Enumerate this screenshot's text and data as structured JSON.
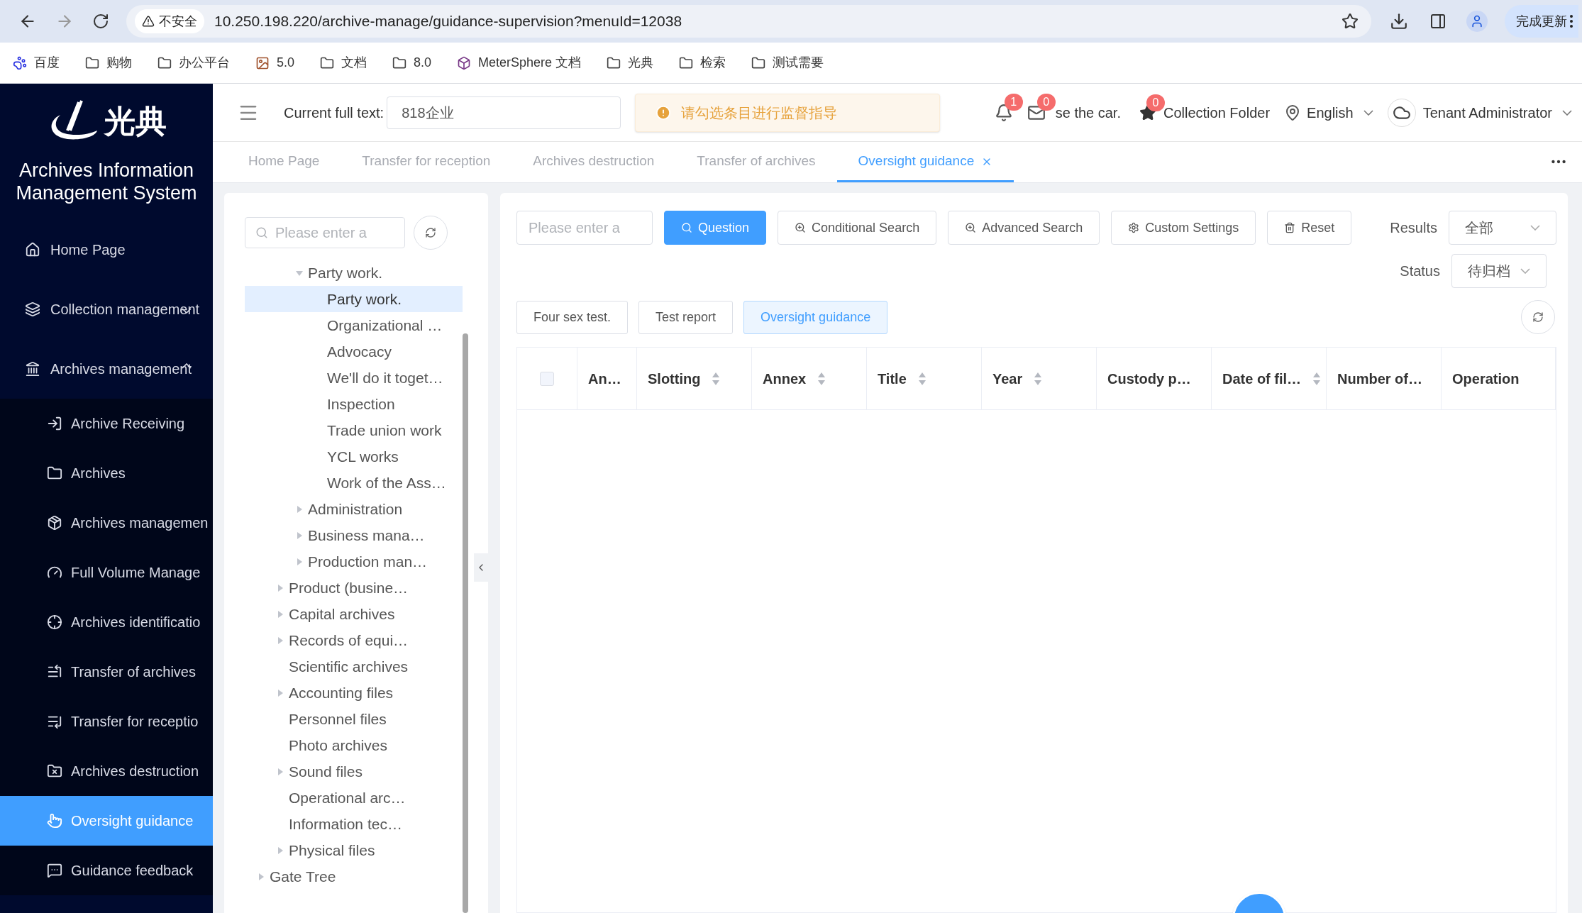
{
  "browser": {
    "security_label": "不安全",
    "url": "10.250.198.220/archive-manage/guidance-supervision?menuId=12038",
    "update_button": "完成更新",
    "bookmarks": [
      {
        "label": "百度",
        "kind": "paw"
      },
      {
        "label": "购物",
        "kind": "folder"
      },
      {
        "label": "办公平台",
        "kind": "folder"
      },
      {
        "label": "5.0",
        "kind": "image"
      },
      {
        "label": "文档",
        "kind": "folder"
      },
      {
        "label": "8.0",
        "kind": "folder"
      },
      {
        "label": "MeterSphere 文档",
        "kind": "cube"
      },
      {
        "label": "光典",
        "kind": "folder"
      },
      {
        "label": "检索",
        "kind": "folder"
      },
      {
        "label": "测试需要",
        "kind": "folder"
      }
    ]
  },
  "sidebar": {
    "logo_text": "光典",
    "title": "Archives Information Management System",
    "items": [
      {
        "label": "Home Page",
        "kind": "link",
        "selected": false
      },
      {
        "label": "Collection management",
        "kind": "submenu",
        "expanded": false,
        "selected": false
      },
      {
        "label": "Archives management",
        "kind": "submenu",
        "expanded": true,
        "selected": false,
        "children": [
          {
            "label": "Archive Receiving",
            "selected": false
          },
          {
            "label": "Archives",
            "selected": false
          },
          {
            "label": "Archives managemen",
            "selected": false
          },
          {
            "label": "Full Volume Manage",
            "selected": false
          },
          {
            "label": "Archives identificatio",
            "selected": false
          },
          {
            "label": "Transfer of archives",
            "selected": false
          },
          {
            "label": "Transfer for receptio",
            "selected": false
          },
          {
            "label": "Archives destruction",
            "selected": false
          },
          {
            "label": "Oversight guidance",
            "selected": true
          },
          {
            "label": "Guidance feedback",
            "selected": false
          }
        ]
      }
    ]
  },
  "header": {
    "search_label": "Current full text:",
    "search_value": "818企业",
    "notifications": [
      {
        "badge": "1"
      },
      {
        "badge": "0",
        "label": "se the car."
      }
    ],
    "collection": {
      "badge": "0",
      "label": "Collection Folder"
    },
    "language": "English",
    "user": "Tenant Administrator"
  },
  "toast": {
    "kind": "warning",
    "message": "请勾选条目进行监督指导"
  },
  "tabs": [
    {
      "label": "Home Page",
      "selected": false
    },
    {
      "label": "Transfer for reception",
      "selected": false
    },
    {
      "label": "Archives destruction",
      "selected": false
    },
    {
      "label": "Transfer of archives",
      "selected": false
    },
    {
      "label": "Oversight guidance",
      "selected": true
    }
  ],
  "tree": {
    "search_placeholder": "Please enter a",
    "nodes": [
      {
        "kind": "group",
        "children": [
          {
            "kind": "group",
            "children": [
              {
                "label": "Party work.",
                "kind": "branch",
                "expanded": true,
                "selected": false,
                "children": [
                  {
                    "label": "Party work.",
                    "kind": "leaf",
                    "selected": true
                  },
                  {
                    "label": "Organizational …",
                    "kind": "leaf",
                    "selected": false
                  },
                  {
                    "label": "Advocacy",
                    "kind": "leaf",
                    "selected": false
                  },
                  {
                    "label": "We'll do it toget…",
                    "kind": "leaf",
                    "selected": false
                  },
                  {
                    "label": "Inspection",
                    "kind": "leaf",
                    "selected": false
                  },
                  {
                    "label": "Trade union work",
                    "kind": "leaf",
                    "selected": false
                  },
                  {
                    "label": "YCL works",
                    "kind": "leaf",
                    "selected": false
                  },
                  {
                    "label": "Work of the Ass…",
                    "kind": "leaf",
                    "selected": false
                  }
                ]
              },
              {
                "label": "Administration",
                "kind": "branch",
                "expanded": false,
                "selected": false
              },
              {
                "label": "Business mana…",
                "kind": "branch",
                "expanded": false,
                "selected": false
              },
              {
                "label": "Production man…",
                "kind": "branch",
                "expanded": false,
                "selected": false
              }
            ]
          },
          {
            "label": "Product (busine…",
            "kind": "branch",
            "expanded": false,
            "selected": false
          },
          {
            "label": "Capital archives",
            "kind": "branch",
            "expanded": false,
            "selected": false
          },
          {
            "label": "Records of equi…",
            "kind": "branch",
            "expanded": false,
            "selected": false
          },
          {
            "label": "Scientific archives",
            "kind": "leaf",
            "selected": false
          },
          {
            "label": "Accounting files",
            "kind": "branch",
            "expanded": false,
            "selected": false
          },
          {
            "label": "Personnel files",
            "kind": "leaf",
            "selected": false
          },
          {
            "label": "Photo archives",
            "kind": "leaf",
            "selected": false
          },
          {
            "label": "Sound files",
            "kind": "branch",
            "expanded": false,
            "selected": false
          },
          {
            "label": "Operational arc…",
            "kind": "leaf",
            "selected": false
          },
          {
            "label": "Information tec…",
            "kind": "leaf",
            "selected": false
          },
          {
            "label": "Physical files",
            "kind": "branch",
            "expanded": false,
            "selected": false
          }
        ]
      },
      {
        "label": "Gate Tree",
        "kind": "branch",
        "expanded": false,
        "selected": false
      }
    ]
  },
  "toolbar": {
    "search_placeholder": "Please enter a",
    "buttons": [
      {
        "label": "Question",
        "kind": "primary"
      },
      {
        "label": "Conditional Search",
        "kind": "conditional"
      },
      {
        "label": "Advanced Search",
        "kind": "advanced"
      },
      {
        "label": "Custom Settings",
        "kind": "settings"
      },
      {
        "label": "Reset",
        "kind": "reset"
      }
    ],
    "filters": [
      {
        "label": "Results",
        "value": "全部"
      },
      {
        "label": "Status",
        "value": "待归档"
      }
    ]
  },
  "categories": [
    {
      "label": "Four sex test.",
      "selected": false
    },
    {
      "label": "Test report",
      "selected": false
    },
    {
      "label": "Oversight guidance",
      "selected": true
    }
  ],
  "table": {
    "select_all_checked": false,
    "columns": [
      {
        "label": "An…",
        "sortable": false
      },
      {
        "label": "Slotting",
        "sortable": true
      },
      {
        "label": "Annex",
        "sortable": true
      },
      {
        "label": "Title",
        "sortable": true
      },
      {
        "label": "Year",
        "sortable": true
      },
      {
        "label": "Custody p…",
        "sortable": false
      },
      {
        "label": "Date of fil…",
        "sortable": true
      },
      {
        "label": "Number of…",
        "sortable": false
      },
      {
        "label": "Operation",
        "sortable": false
      }
    ]
  }
}
